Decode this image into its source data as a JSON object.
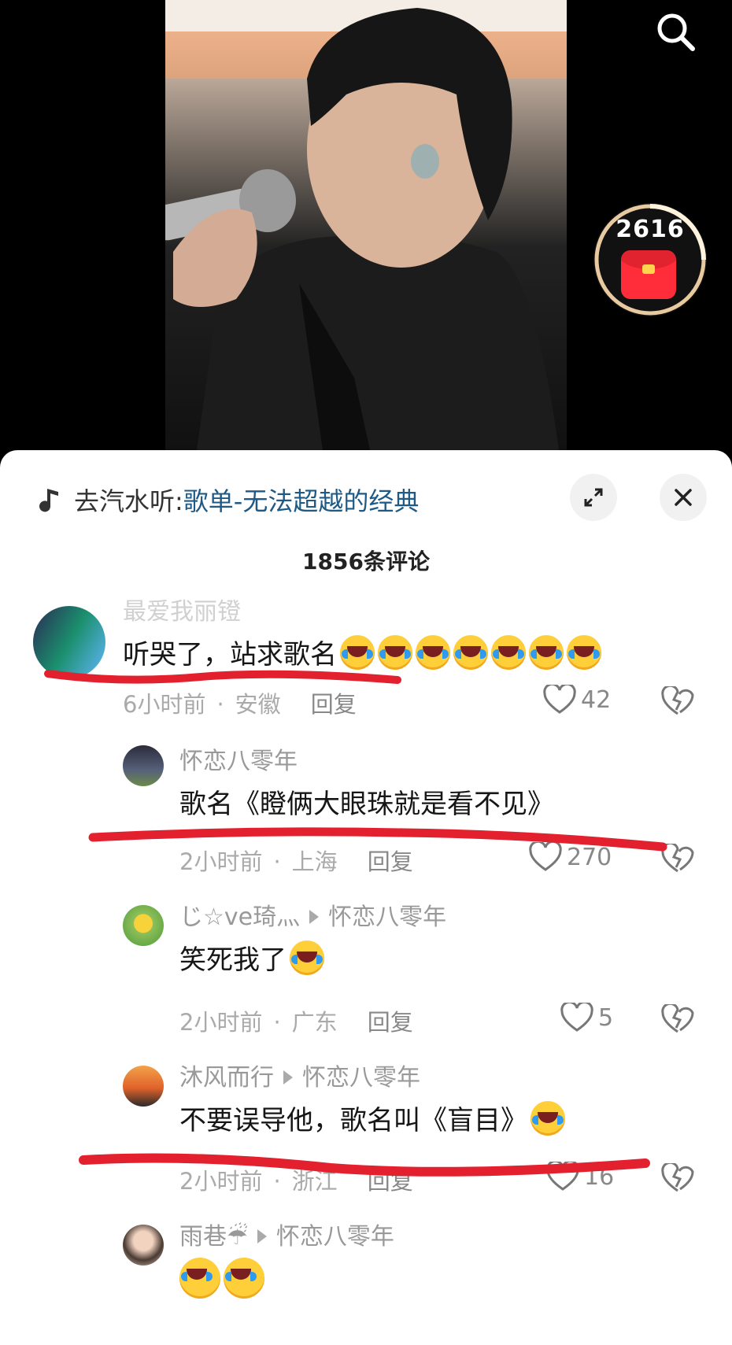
{
  "video": {
    "search_icon": "search-icon",
    "red_packet": {
      "count": "2616",
      "icon": "red-envelope-icon",
      "accent": "#ff2d3a"
    }
  },
  "sheet": {
    "music_prefix": "去汽水听: ",
    "playlist": "歌单-无法超越的经典",
    "comment_count": "1856条评论",
    "expand_icon": "expand-icon",
    "close_icon": "close-icon"
  },
  "comments": [
    {
      "user": "最爱我丽镫",
      "text": "听哭了，站求歌名",
      "emoji_count": 7,
      "time": "6小时前",
      "region": "安徽",
      "reply": "回复",
      "likes": "42"
    },
    {
      "user": "怀恋八零年",
      "text": "歌名《瞪俩大眼珠就是看不见》",
      "time": "2小时前",
      "region": "上海",
      "reply": "回复",
      "likes": "270"
    },
    {
      "user": "じ☆ve琦灬",
      "reply_to": "怀恋八零年",
      "text": "笑死我了",
      "emoji_count": 1,
      "time": "2小时前",
      "region": "广东",
      "reply": "回复",
      "likes": "5"
    },
    {
      "user": "沐风而行",
      "reply_to": "怀恋八零年",
      "text": "不要误导他，歌名叫《盲目》",
      "emoji_count": 1,
      "time": "2小时前",
      "region": "浙江",
      "reply": "回复",
      "likes": "16"
    },
    {
      "user": "雨巷☔",
      "reply_to": "怀恋八零年",
      "text": "",
      "emoji_count": 2
    }
  ],
  "colors": {
    "link": "#1e5a85",
    "annotation": "#e3202e",
    "muted": "#aaaaaa"
  }
}
